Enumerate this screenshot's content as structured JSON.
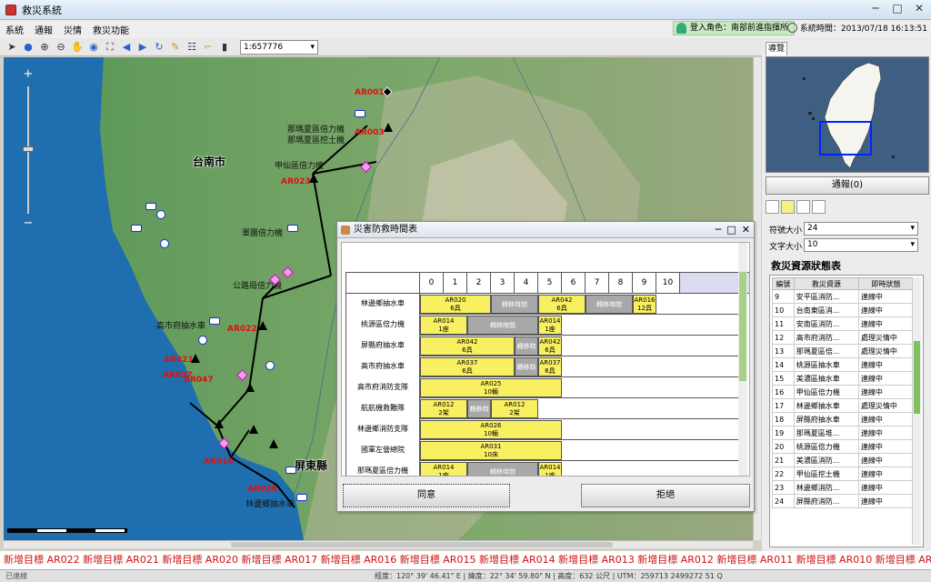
{
  "window": {
    "title": "救災系統",
    "controls": [
      "─",
      "□",
      "✕"
    ]
  },
  "menu": [
    "系統",
    "通報",
    "災情",
    "救災功能"
  ],
  "login": "登入角色：南部前進指揮所",
  "clock": "系統時間：2013/07/18 16:13:51",
  "toolbar": {
    "scale": "1:657776"
  },
  "map": {
    "cities": {
      "tainan": "台南市",
      "pingtung": "屏東縣"
    },
    "zoom_plus": "+",
    "zoom_minus": "−",
    "labels": {
      "ar001": "AR001",
      "ar003": "AR003",
      "ar023": "AR023",
      "ar022": "AR022",
      "ar021": "AR021",
      "ar016": "AR016",
      "ar028": "AR028",
      "ar037": "AR037",
      "ar047": "AR047",
      "nm1": "那瑪夏區倍力機",
      "nm2": "那瑪夏區挖土機",
      "nm3": "甲仙區倍力機",
      "army": "軍團倍力機",
      "road": "公路局倍力機",
      "gs": "高市府抽水車",
      "lb": "林邊鄉抽水車"
    }
  },
  "marquee": "新增目標 AR022   新增目標 AR021   新增目標 AR020   新增目標 AR017   新增目標 AR016   新增目標 AR015   新增目標 AR014   新增目標 AR013   新增目標 AR012   新增目標 AR011   新增目標 AR010   新增目標 AR007   新增目標 AR006",
  "status": {
    "connection": "已連線",
    "coords": "經度：120° 39' 46.41\" E  |  緯度：22° 34' 59.80\" N  |  高度：632 公尺  |  UTM：259713 2499272 51 Q"
  },
  "right_panel": {
    "nav_tab": "導覽",
    "report_button": "通報(0)",
    "symbol_size_label": "符號大小",
    "symbol_size": "24",
    "text_size_label": "文字大小",
    "text_size": "10",
    "status_title": "救災資源狀態表",
    "table_headers": [
      "編號",
      "救災資源",
      "即時狀態"
    ],
    "table_rows": [
      [
        "9",
        "安平區消防...",
        "連線中"
      ],
      [
        "10",
        "台南東區消...",
        "連線中"
      ],
      [
        "11",
        "安南區消防...",
        "連線中"
      ],
      [
        "12",
        "高市府消防...",
        "處理災情中"
      ],
      [
        "13",
        "那瑪夏區倍...",
        "處理災情中"
      ],
      [
        "14",
        "桃源區抽水車",
        "連線中"
      ],
      [
        "15",
        "美濃區抽水車",
        "連線中"
      ],
      [
        "16",
        "甲仙區倍力機",
        "連線中"
      ],
      [
        "17",
        "林邊鄉抽水車",
        "處理災情中"
      ],
      [
        "18",
        "屏縣府抽水車",
        "連線中"
      ],
      [
        "19",
        "那瑪夏區堆...",
        "連線中"
      ],
      [
        "20",
        "桃源區倍力機",
        "連線中"
      ],
      [
        "21",
        "美濃區消防...",
        "連線中"
      ],
      [
        "22",
        "甲仙區挖土機",
        "連線中"
      ],
      [
        "23",
        "林邊鄉消防...",
        "連線中"
      ],
      [
        "24",
        "屏縣府消防...",
        "連線中"
      ]
    ]
  },
  "dialog": {
    "title": "災害防救時間表",
    "hours": [
      "0",
      "1",
      "2",
      "3",
      "4",
      "5",
      "6",
      "7",
      "8",
      "9",
      "10"
    ],
    "rows": [
      {
        "label": "林邊鄉抽水車",
        "bars": [
          {
            "kind": "y",
            "start": 0,
            "end": 3,
            "text": "AR020",
            "sub": "6具"
          },
          {
            "kind": "g",
            "start": 3,
            "end": 5,
            "text": "轉移時間",
            "sub": ""
          },
          {
            "kind": "y",
            "start": 5,
            "end": 7,
            "text": "AR042",
            "sub": "6具"
          },
          {
            "kind": "g",
            "start": 7,
            "end": 9,
            "text": "轉移時間",
            "sub": ""
          },
          {
            "kind": "y",
            "start": 9,
            "end": 10,
            "text": "AR016",
            "sub": "12具"
          }
        ]
      },
      {
        "label": "桃源區倍力機",
        "bars": [
          {
            "kind": "y",
            "start": 0,
            "end": 2,
            "text": "AR014",
            "sub": "1座"
          },
          {
            "kind": "g",
            "start": 2,
            "end": 5,
            "text": "轉移時間",
            "sub": ""
          },
          {
            "kind": "y",
            "start": 5,
            "end": 6,
            "text": "AR014",
            "sub": "1座"
          }
        ]
      },
      {
        "label": "屏縣府抽水車",
        "bars": [
          {
            "kind": "y",
            "start": 0,
            "end": 4,
            "text": "AR042",
            "sub": "6具"
          },
          {
            "kind": "g",
            "start": 4,
            "end": 5,
            "text": "轉移時間",
            "sub": ""
          },
          {
            "kind": "y",
            "start": 5,
            "end": 6,
            "text": "AR042",
            "sub": "6具"
          }
        ]
      },
      {
        "label": "高市府抽水車",
        "bars": [
          {
            "kind": "y",
            "start": 0,
            "end": 4,
            "text": "AR037",
            "sub": "6具"
          },
          {
            "kind": "g",
            "start": 4,
            "end": 5,
            "text": "轉移時間",
            "sub": ""
          },
          {
            "kind": "y",
            "start": 5,
            "end": 6,
            "text": "AR037",
            "sub": "6具"
          }
        ]
      },
      {
        "label": "高市府消防支隊",
        "bars": [
          {
            "kind": "y",
            "start": 0,
            "end": 6,
            "text": "AR025",
            "sub": "10輛"
          }
        ]
      },
      {
        "label": "航航機救難隊",
        "bars": [
          {
            "kind": "y",
            "start": 0,
            "end": 2,
            "text": "AR012",
            "sub": "2架"
          },
          {
            "kind": "g",
            "start": 2,
            "end": 3,
            "text": "轉移時間",
            "sub": ""
          },
          {
            "kind": "y",
            "start": 3,
            "end": 5,
            "text": "AR012",
            "sub": "2架"
          }
        ]
      },
      {
        "label": "林邊鄉消防支隊",
        "bars": [
          {
            "kind": "y",
            "start": 0,
            "end": 6,
            "text": "AR026",
            "sub": "10輛"
          }
        ]
      },
      {
        "label": "國軍左營總院",
        "bars": [
          {
            "kind": "y",
            "start": 0,
            "end": 6,
            "text": "AR031",
            "sub": "10床"
          }
        ]
      },
      {
        "label": "那瑪夏區倍力機",
        "bars": [
          {
            "kind": "y",
            "start": 0,
            "end": 2,
            "text": "AR014",
            "sub": "1座"
          },
          {
            "kind": "g",
            "start": 2,
            "end": 5,
            "text": "轉移時間",
            "sub": ""
          },
          {
            "kind": "y",
            "start": 5,
            "end": 6,
            "text": "AR014",
            "sub": "1座"
          }
        ]
      }
    ],
    "accept": "同意",
    "reject": "拒絕"
  }
}
